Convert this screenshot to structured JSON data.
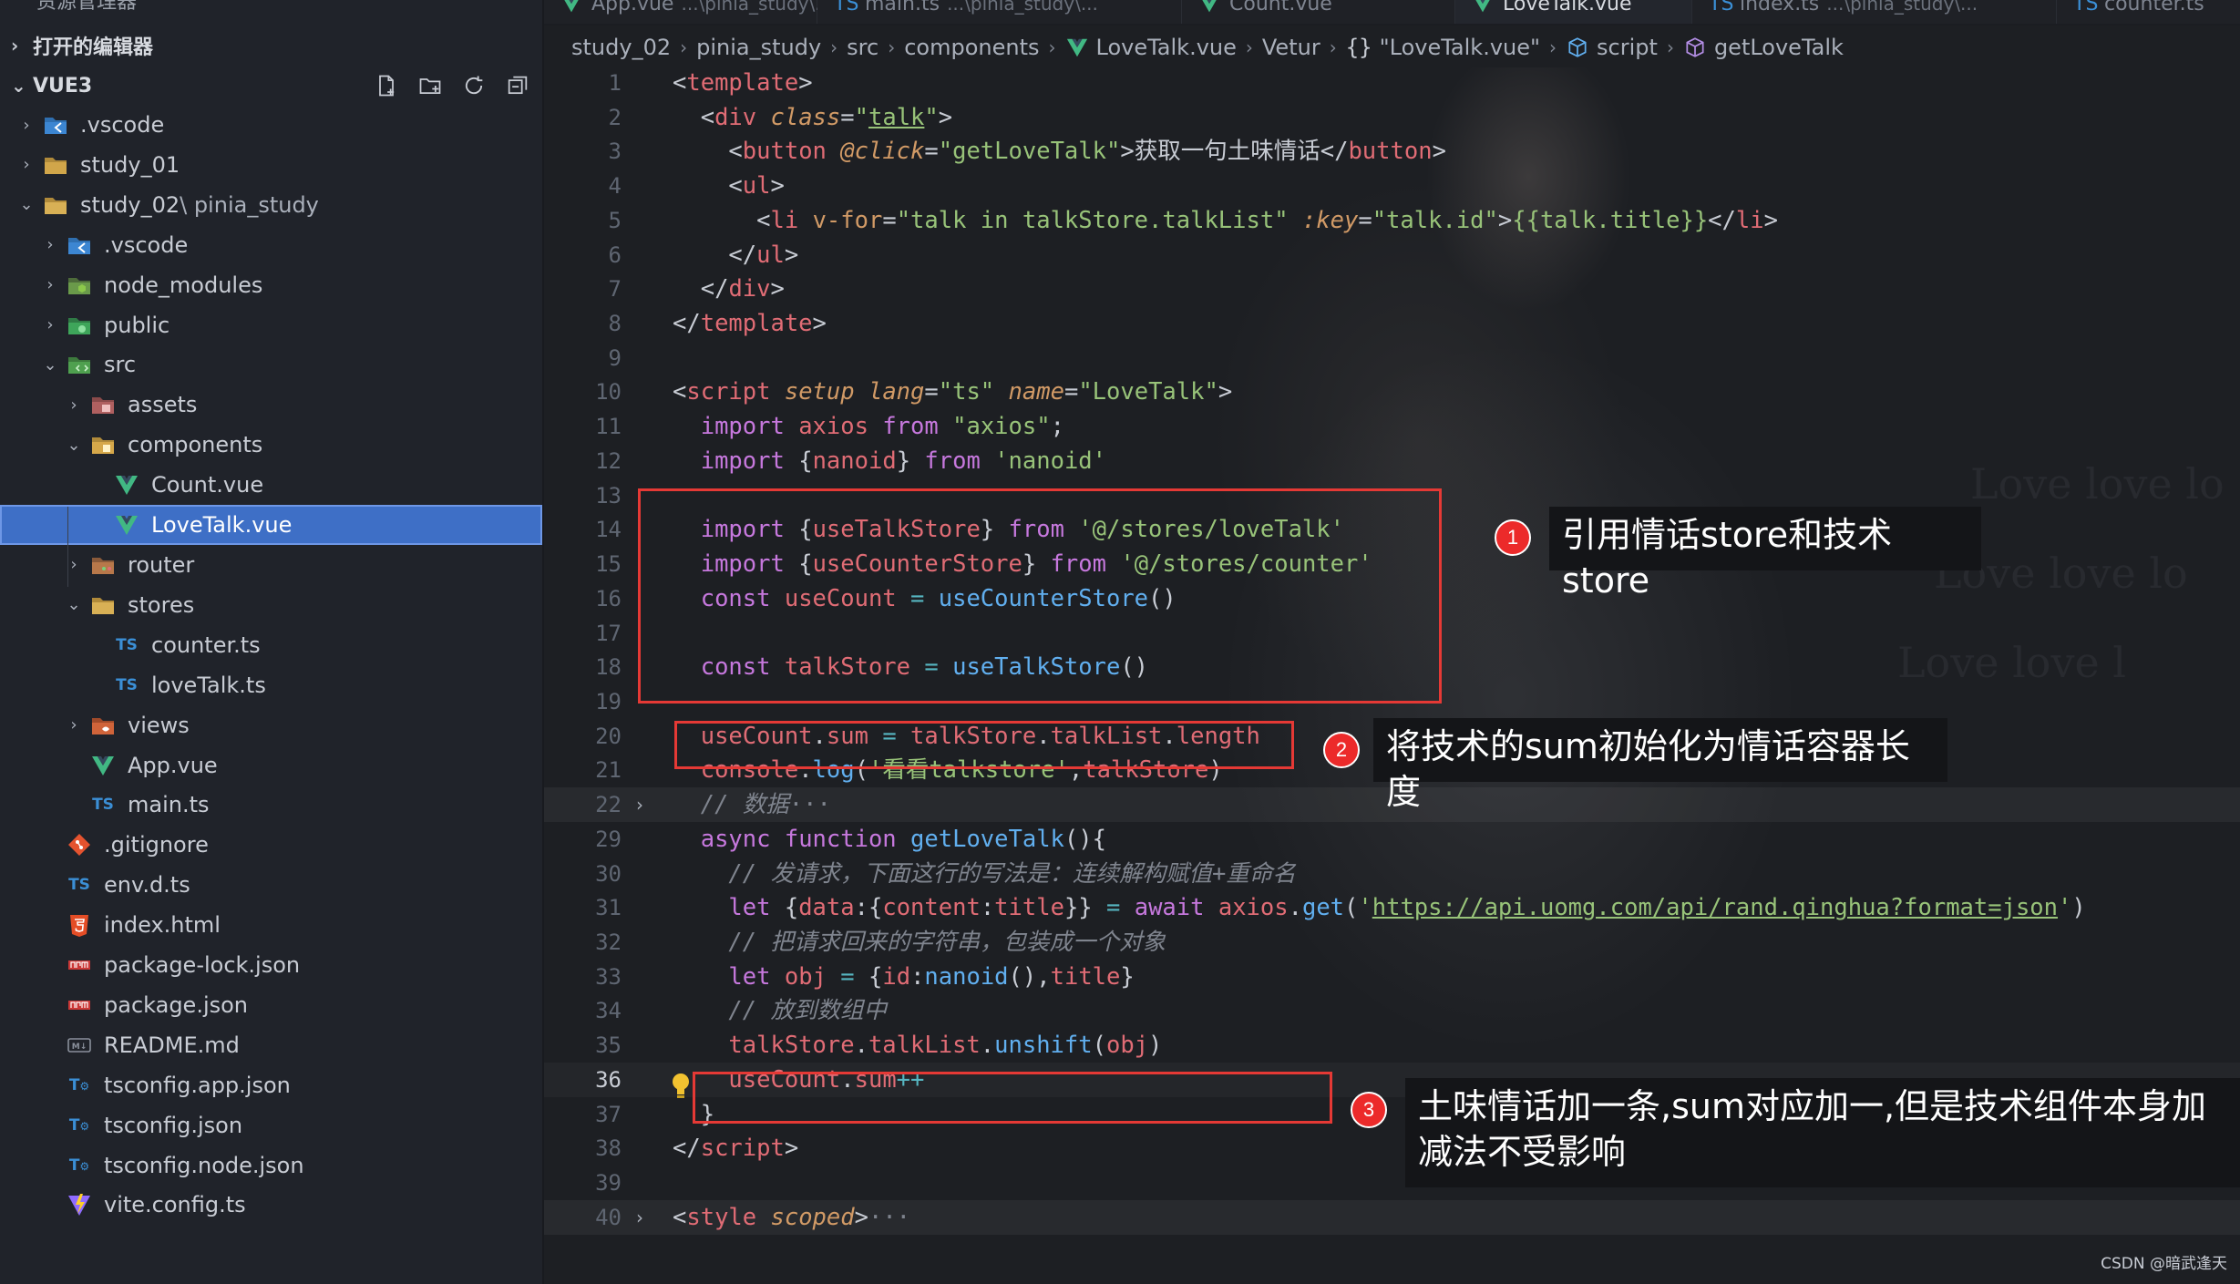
{
  "sidebar": {
    "explorer_title": "资源管理器",
    "open_editors": "打开的编辑器",
    "workspace": "VUE3",
    "actions": [
      "new-file-icon",
      "new-folder-icon",
      "refresh-icon",
      "collapse-all-icon"
    ],
    "tree": [
      {
        "label": "vscode",
        "prefix": ".",
        "suffix": "",
        "icon": "vscode-folder-icon",
        "chev": "›",
        "depth": 0
      },
      {
        "label": "study_01",
        "prefix": "",
        "suffix": "",
        "icon": "folder-icon",
        "chev": "›",
        "depth": 0
      },
      {
        "label": "study_02",
        "prefix": "",
        "suffix": " \\ pinia_study",
        "icon": "folder-open-icon",
        "chev": "⌄",
        "depth": 0
      },
      {
        "label": "vscode",
        "prefix": ".",
        "suffix": "",
        "icon": "vscode-folder-icon",
        "chev": "›",
        "depth": 1
      },
      {
        "label": "node_modules",
        "prefix": "",
        "suffix": "",
        "icon": "node-folder-icon",
        "chev": "›",
        "depth": 1
      },
      {
        "label": "public",
        "prefix": "",
        "suffix": "",
        "icon": "public-folder-icon",
        "chev": "›",
        "depth": 1
      },
      {
        "label": "src",
        "prefix": "",
        "suffix": "",
        "icon": "src-folder-icon",
        "chev": "⌄",
        "depth": 1
      },
      {
        "label": "assets",
        "prefix": "",
        "suffix": "",
        "icon": "assets-folder-icon",
        "chev": "›",
        "depth": 2
      },
      {
        "label": "components",
        "prefix": "",
        "suffix": "",
        "icon": "components-folder-icon",
        "chev": "⌄",
        "depth": 2
      },
      {
        "label": "Count.vue",
        "prefix": "",
        "suffix": "",
        "icon": "vue-file-icon",
        "chev": "",
        "depth": 3
      },
      {
        "label": "LoveTalk.vue",
        "prefix": "",
        "suffix": "",
        "icon": "vue-file-icon",
        "chev": "",
        "depth": 3,
        "selected": true
      },
      {
        "label": "router",
        "prefix": "",
        "suffix": "",
        "icon": "router-folder-icon",
        "chev": "›",
        "depth": 2
      },
      {
        "label": "stores",
        "prefix": "",
        "suffix": "",
        "icon": "folder-open-icon",
        "chev": "⌄",
        "depth": 2
      },
      {
        "label": "counter.ts",
        "prefix": "",
        "suffix": "",
        "icon": "ts-file-icon",
        "chev": "",
        "depth": 3
      },
      {
        "label": "loveTalk.ts",
        "prefix": "",
        "suffix": "",
        "icon": "ts-file-icon",
        "chev": "",
        "depth": 3
      },
      {
        "label": "views",
        "prefix": "",
        "suffix": "",
        "icon": "views-folder-icon",
        "chev": "›",
        "depth": 2
      },
      {
        "label": "App.vue",
        "prefix": "",
        "suffix": "",
        "icon": "vue-file-icon",
        "chev": "",
        "depth": 2
      },
      {
        "label": "main.ts",
        "prefix": "",
        "suffix": "",
        "icon": "ts-file-icon",
        "chev": "",
        "depth": 2
      },
      {
        "label": "gitignore",
        "prefix": ".",
        "suffix": "",
        "icon": "git-file-icon",
        "chev": "",
        "depth": 1
      },
      {
        "label": "env.d.ts",
        "prefix": "",
        "suffix": "",
        "icon": "ts-file-icon",
        "chev": "",
        "depth": 1
      },
      {
        "label": "index.html",
        "prefix": "",
        "suffix": "",
        "icon": "html-file-icon",
        "chev": "",
        "depth": 1
      },
      {
        "label": "package-lock.json",
        "prefix": "",
        "suffix": "",
        "icon": "npm-file-icon",
        "chev": "",
        "depth": 1
      },
      {
        "label": "package.json",
        "prefix": "",
        "suffix": "",
        "icon": "npm-file-icon",
        "chev": "",
        "depth": 1
      },
      {
        "label": "README.md",
        "prefix": "",
        "suffix": "",
        "icon": "markdown-file-icon",
        "chev": "",
        "depth": 1
      },
      {
        "label": "tsconfig.app.json",
        "prefix": "",
        "suffix": "",
        "icon": "tsconfig-file-icon",
        "chev": "",
        "depth": 1
      },
      {
        "label": "tsconfig.json",
        "prefix": "",
        "suffix": "",
        "icon": "tsconfig-file-icon",
        "chev": "",
        "depth": 1
      },
      {
        "label": "tsconfig.node.json",
        "prefix": "",
        "suffix": "",
        "icon": "tsconfig-file-icon",
        "chev": "",
        "depth": 1
      },
      {
        "label": "vite.config.ts",
        "prefix": "",
        "suffix": "",
        "icon": "vite-file-icon",
        "chev": "",
        "depth": 1
      }
    ]
  },
  "tabs": [
    {
      "label": "App.vue",
      "sub": "...\\pinia_study\\...",
      "active": false
    },
    {
      "label": "main.ts",
      "sub": "...\\pinia_study\\...",
      "active": false
    },
    {
      "label": "Count.vue",
      "sub": "",
      "active": false
    },
    {
      "label": "LoveTalk.vue",
      "sub": "",
      "active": true
    },
    {
      "label": "index.ts",
      "sub": "...\\pinia_study\\...",
      "active": false
    },
    {
      "label": "counter.ts",
      "sub": "",
      "active": false
    }
  ],
  "breadcrumb": [
    {
      "label": "study_02",
      "icon": ""
    },
    {
      "label": "pinia_study",
      "icon": ""
    },
    {
      "label": "src",
      "icon": ""
    },
    {
      "label": "components",
      "icon": ""
    },
    {
      "label": "LoveTalk.vue",
      "icon": "vue-file-icon"
    },
    {
      "label": "Vetur",
      "icon": ""
    },
    {
      "label": "\"LoveTalk.vue\"",
      "icon": "braces-icon"
    },
    {
      "label": "script",
      "icon": "cube-icon"
    },
    {
      "label": "getLoveTalk",
      "icon": "method-icon"
    }
  ],
  "code_lines": [
    {
      "n": "1",
      "fold": "",
      "html": "<span class='t-punc'>&lt;</span><span class='t-tag'>template</span><span class='t-punc'>&gt;</span>"
    },
    {
      "n": "2",
      "fold": "",
      "html": "  <span class='t-punc'>&lt;</span><span class='t-tag'>div</span> <span class='t-attr-i'>class</span><span class='t-punc'>=</span><span class='t-str'>\"<u>talk</u>\"</span><span class='t-punc'>&gt;</span>"
    },
    {
      "n": "3",
      "fold": "",
      "html": "    <span class='t-punc'>&lt;</span><span class='t-tag'>button</span> <span class='t-attr-i'>@click</span><span class='t-punc'>=</span><span class='t-str'>\"getLoveTalk\"</span><span class='t-punc'>&gt;</span>获取一句土味情话<span class='t-punc'>&lt;/</span><span class='t-tag'>button</span><span class='t-punc'>&gt;</span>"
    },
    {
      "n": "4",
      "fold": "",
      "html": "    <span class='t-punc'>&lt;</span><span class='t-tag'>ul</span><span class='t-punc'>&gt;</span>"
    },
    {
      "n": "5",
      "fold": "",
      "html": "      <span class='t-punc'>&lt;</span><span class='t-tag'>li</span> <span class='t-attr'>v-for</span><span class='t-punc'>=</span><span class='t-str'>\"talk in talkStore.talkList\"</span> <span class='t-attr-i'>:key</span><span class='t-punc'>=</span><span class='t-str'>\"talk.id\"</span><span class='t-punc'>&gt;</span><span class='t-str'>{{talk.title}}</span><span class='t-punc'>&lt;/</span><span class='t-tag'>li</span><span class='t-punc'>&gt;</span>"
    },
    {
      "n": "6",
      "fold": "",
      "html": "    <span class='t-punc'>&lt;/</span><span class='t-tag'>ul</span><span class='t-punc'>&gt;</span>"
    },
    {
      "n": "7",
      "fold": "",
      "html": "  <span class='t-punc'>&lt;/</span><span class='t-tag'>div</span><span class='t-punc'>&gt;</span>"
    },
    {
      "n": "8",
      "fold": "",
      "html": "<span class='t-punc'>&lt;/</span><span class='t-tag'>template</span><span class='t-punc'>&gt;</span>"
    },
    {
      "n": "9",
      "fold": "",
      "html": ""
    },
    {
      "n": "10",
      "fold": "",
      "html": "<span class='t-punc'>&lt;</span><span class='t-tag'>script</span> <span class='t-attr-i'>setup</span> <span class='t-attr-i'>lang</span><span class='t-punc'>=</span><span class='t-str'>\"ts\"</span> <span class='t-attr-i'>name</span><span class='t-punc'>=</span><span class='t-str'>\"LoveTalk\"</span><span class='t-punc'>&gt;</span>"
    },
    {
      "n": "11",
      "fold": "",
      "html": "  <span class='t-kw'>import</span> <span class='t-var'>axios</span> <span class='t-kw'>from</span> <span class='t-str'>\"axios\"</span>;"
    },
    {
      "n": "12",
      "fold": "",
      "html": "  <span class='t-kw'>import</span> {<span class='t-var'>nanoid</span>} <span class='t-kw'>from</span> <span class='t-str'>'nanoid'</span>"
    },
    {
      "n": "13",
      "fold": "",
      "html": ""
    },
    {
      "n": "14",
      "fold": "",
      "html": "  <span class='t-kw'>import</span> {<span class='t-var'>useTalkStore</span>} <span class='t-kw'>from</span> <span class='t-str'>'@/stores/loveTalk'</span>"
    },
    {
      "n": "15",
      "fold": "",
      "html": "  <span class='t-kw'>import</span> {<span class='t-var'>useCounterStore</span>} <span class='t-kw'>from</span> <span class='t-str'>'@/stores/counter'</span>"
    },
    {
      "n": "16",
      "fold": "",
      "html": "  <span class='t-kw'>const</span> <span class='t-var'>useCount</span> <span class='t-op'>=</span> <span class='t-fn'>useCounterStore</span>()"
    },
    {
      "n": "17",
      "fold": "",
      "html": ""
    },
    {
      "n": "18",
      "fold": "",
      "html": "  <span class='t-kw'>const</span> <span class='t-var'>talkStore</span> <span class='t-op'>=</span> <span class='t-fn'>useTalkStore</span>()"
    },
    {
      "n": "19",
      "fold": "",
      "html": ""
    },
    {
      "n": "20",
      "fold": "",
      "html": "  <span class='t-var'>useCount</span>.<span class='t-var'>sum</span> <span class='t-op'>=</span> <span class='t-var'>talkStore</span>.<span class='t-var'>talkList</span>.<span class='t-var'>length</span>"
    },
    {
      "n": "21",
      "fold": "",
      "html": "  <span class='t-var'>console</span>.<span class='t-fn'>log</span>(<span class='t-str'>'看看talkstore'</span>,<span class='t-var'>talkStore</span>)"
    },
    {
      "n": "22",
      "fold": "›",
      "folded": true,
      "html": "  <span class='t-cmt'>// 数据</span><span class='fold-dots'>···</span>"
    },
    {
      "n": "29",
      "fold": "",
      "html": "  <span class='t-kw'>async</span> <span class='t-kw'>function</span> <span class='t-fn'>getLoveTalk</span>(){"
    },
    {
      "n": "30",
      "fold": "",
      "html": "    <span class='t-cmt'>// 发请求，下面这行的写法是：连续解构赋值+重命名</span>"
    },
    {
      "n": "31",
      "fold": "",
      "html": "    <span class='t-kw'>let</span> {<span class='t-var'>data</span>:{<span class='t-var'>content</span>:<span class='t-var'>title</span>}} <span class='t-op'>=</span> <span class='t-kw'>await</span> <span class='t-var'>axios</span>.<span class='t-fn'>get</span>(<span class='t-str'>'</span><span class='t-url'>https://api.uomg.com/api/rand.qinghua?format=json</span><span class='t-str'>'</span>)"
    },
    {
      "n": "32",
      "fold": "",
      "html": "    <span class='t-cmt'>// 把请求回来的字符串，包装成一个对象</span>"
    },
    {
      "n": "33",
      "fold": "",
      "html": "    <span class='t-kw'>let</span> <span class='t-var'>obj</span> <span class='t-op'>=</span> {<span class='t-var'>id</span>:<span class='t-fn'>nanoid</span>(),<span class='t-var'>title</span>}"
    },
    {
      "n": "34",
      "fold": "",
      "html": "    <span class='t-cmt'>// 放到数组中</span>"
    },
    {
      "n": "35",
      "fold": "",
      "html": "    <span class='t-var'>talkStore</span>.<span class='t-var'>talkList</span>.<span class='t-fn'>unshift</span>(<span class='t-var'>obj</span>)"
    },
    {
      "n": "36",
      "fold": "",
      "current": true,
      "html": "    <span class='t-var'>useCount</span>.<span class='t-var'>sum</span><span class='t-op'>++</span>"
    },
    {
      "n": "37",
      "fold": "",
      "html": "  }"
    },
    {
      "n": "38",
      "fold": "",
      "html": "<span class='t-punc'>&lt;/</span><span class='t-tag'>script</span><span class='t-punc'>&gt;</span>"
    },
    {
      "n": "39",
      "fold": "",
      "html": ""
    },
    {
      "n": "40",
      "fold": "›",
      "folded": true,
      "html": "<span class='t-punc'>&lt;</span><span class='t-tag'>style</span> <span class='t-attr-i'>scoped</span><span class='t-punc'>&gt;</span><span class='fold-dots'>···</span>"
    }
  ],
  "annotations": [
    {
      "number": "1",
      "text": "引用情话store和技术store"
    },
    {
      "number": "2",
      "text": "将技术的sum初始化为情话容器长度"
    },
    {
      "number": "3",
      "text": "土味情话加一条,sum对应加一,但是技术组件本身加减法不受影响"
    }
  ],
  "watermark_lines": [
    "Love love lo",
    "Love love lo",
    "Love love l"
  ],
  "credit": "CSDN @暗武逢天",
  "colors": {
    "selection": "#3e6fc6",
    "annotation_red": "#e53935",
    "callout_bg": "#141518"
  }
}
